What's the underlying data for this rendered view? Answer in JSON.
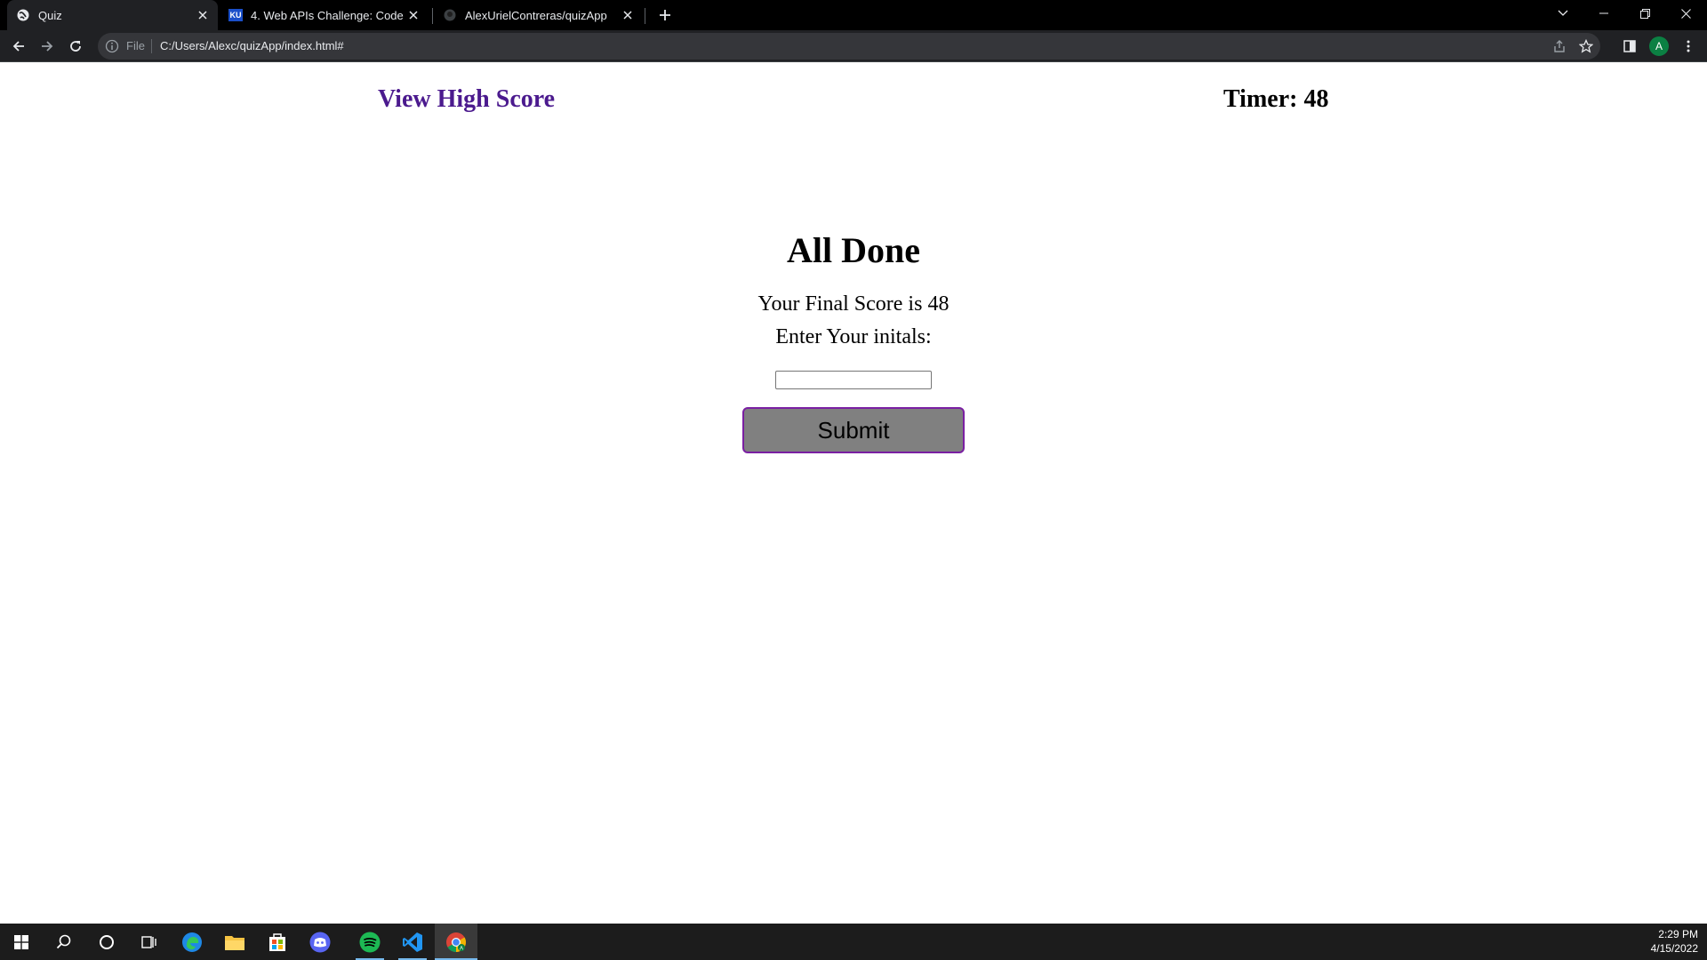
{
  "browser": {
    "tabs": [
      {
        "title": "Quiz",
        "icon": "globe-icon",
        "active": true
      },
      {
        "title": "4. Web APIs Challenge: Code Qu",
        "icon": "ku-favicon",
        "favicon_text": "KU",
        "active": false
      },
      {
        "title": "AlexUrielContreras/quizApp",
        "icon": "github-icon",
        "active": false
      }
    ],
    "address": {
      "scheme_label": "File",
      "url": "C:/Users/Alexc/quizApp/index.html#"
    },
    "profile_initial": "A"
  },
  "page": {
    "high_score_link": "View High Score",
    "timer_text": "Timer: 48",
    "title": "All Done",
    "final_score_text": "Your Final Score is 48",
    "initials_label": "Enter Your initals:",
    "initials_value": "",
    "submit_label": "Submit"
  },
  "taskbar": {
    "apps": [
      "windows-start-icon",
      "search-icon",
      "cortana-icon",
      "task-view-icon",
      "edge-icon",
      "file-explorer-icon",
      "store-icon",
      "discord-icon",
      "spotify-icon",
      "vscode-icon",
      "chrome-icon"
    ],
    "time": "2:29 PM",
    "date": "4/15/2022"
  },
  "colors": {
    "link": "#4b1a8e",
    "submit_bg": "#808080",
    "submit_border": "#7a1fa2"
  }
}
